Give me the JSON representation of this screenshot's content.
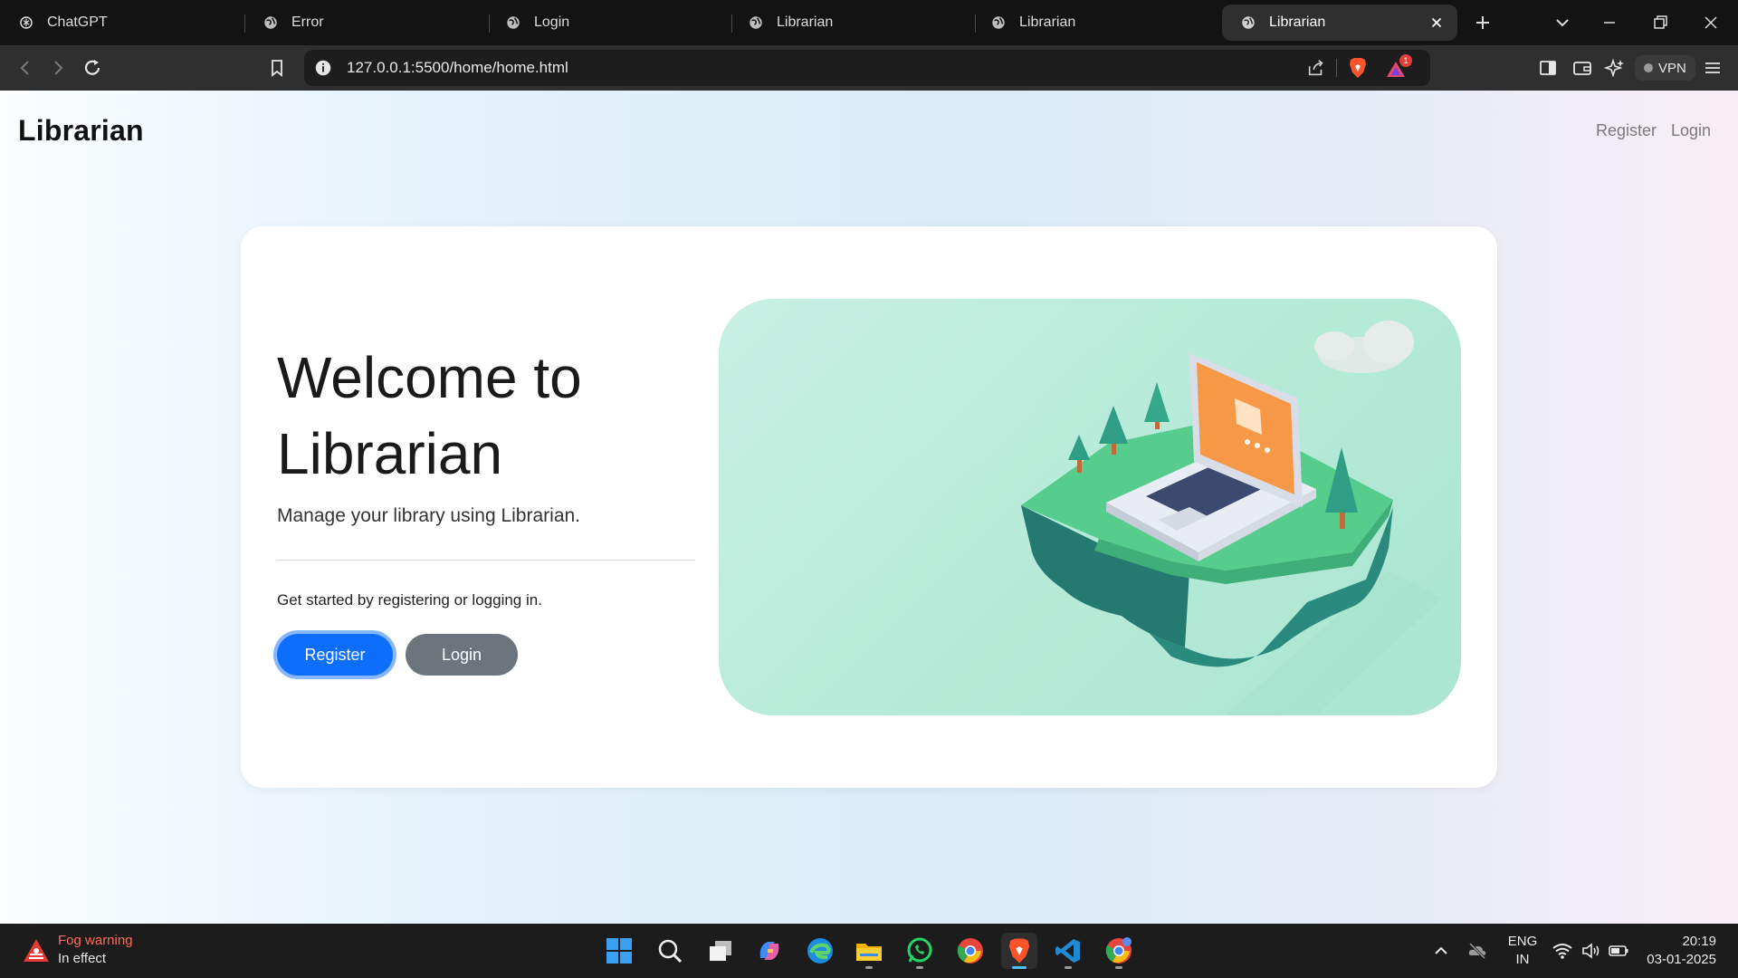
{
  "browser": {
    "tabs": [
      {
        "label": "ChatGPT",
        "icon": "chatgpt-icon"
      },
      {
        "label": "Error",
        "icon": "globe-icon"
      },
      {
        "label": "Login",
        "icon": "globe-icon"
      },
      {
        "label": "Librarian",
        "icon": "globe-icon"
      },
      {
        "label": "Librarian",
        "icon": "globe-icon"
      },
      {
        "label": "Librarian",
        "icon": "globe-icon",
        "active": true
      }
    ],
    "url": "127.0.0.1:5500/home/home.html",
    "rewards_badge": "1",
    "vpn_label": "VPN"
  },
  "page": {
    "brand": "Librarian",
    "nav": {
      "register": "Register",
      "login": "Login"
    },
    "hero": {
      "title": "Welcome to Librarian",
      "subtitle": "Manage your library using Librarian.",
      "cta_text": "Get started by registering or logging in.",
      "register_button": "Register",
      "login_button": "Login"
    }
  },
  "taskbar": {
    "weather": {
      "title": "Fog warning",
      "subtitle": "In effect"
    },
    "apps": [
      "start-icon",
      "search-icon",
      "task-view-icon",
      "copilot-icon",
      "edge-icon",
      "file-explorer-icon",
      "whatsapp-icon",
      "chrome-icon",
      "brave-icon",
      "vscode-icon",
      "chrome-dev-icon"
    ],
    "language": {
      "line1": "ENG",
      "line2": "IN"
    },
    "time": "20:19",
    "date": "03-01-2025"
  },
  "colors": {
    "primary": "#0d6efd",
    "secondary": "#6c757d",
    "illustration_bg": "#b5ead7"
  }
}
